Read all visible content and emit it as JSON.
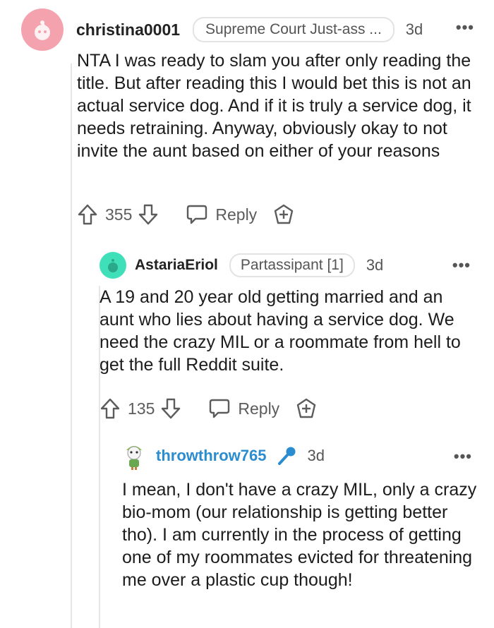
{
  "comments": [
    {
      "username": "christina0001",
      "flair": "Supreme Court Just-ass ...",
      "age": "3d",
      "more": "•••",
      "body": "NTA I was ready to slam you after only reading the title. But after reading this I would bet this is not an actual service dog. And if it is truly a service dog, it needs retraining. Anyway, obviously okay to not invite the aunt based on either of your reasons",
      "score": "355",
      "reply_label": "Reply",
      "avatar_color": "#f4a3ae"
    },
    {
      "username": "AstariaEriol",
      "flair": "Partassipant [1]",
      "age": "3d",
      "more": "•••",
      "body": "A 19 and 20 year old getting married and an aunt who lies about having a service dog. We need the crazy MIL or a roommate from hell to get the full Reddit suite.",
      "score": "135",
      "reply_label": "Reply",
      "avatar_color": "#3fe0b9"
    },
    {
      "username": "throwthrow765",
      "age": "3d",
      "more": "•••",
      "body": "I mean, I don't have a crazy MIL, only a crazy bio-mom (our relationship is getting better tho). I am currently in the process of getting one of my roommates evicted for threatening me over a plastic cup though!",
      "username_color": "#2b8ccf",
      "badge_icon": "microphone-icon"
    }
  ],
  "icons": {
    "upvote": "upvote-arrow-icon",
    "downvote": "downvote-arrow-icon",
    "reply": "speech-bubble-icon",
    "award": "award-plus-icon"
  }
}
